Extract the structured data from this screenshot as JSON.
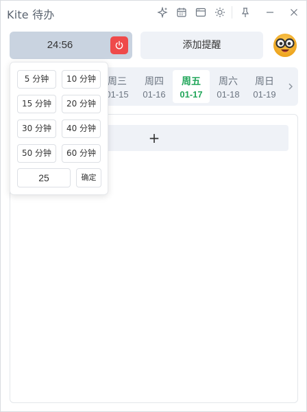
{
  "window": {
    "title": "Kite 待办"
  },
  "titlebar_icons": [
    "sparkle-icon",
    "calendar-icon",
    "window-icon",
    "sun-icon",
    "pin-icon",
    "minimize-icon",
    "close-icon"
  ],
  "timer": {
    "display": "24:56",
    "power_icon": "power-icon",
    "accent": "#ef4a4a"
  },
  "reminder": {
    "label": "添加提醒"
  },
  "week": {
    "days": [
      {
        "name": "周三",
        "date": "01-15"
      },
      {
        "name": "周四",
        "date": "01-16"
      },
      {
        "name": "周五",
        "date": "01-17",
        "active": true
      },
      {
        "name": "周六",
        "date": "01-18"
      },
      {
        "name": "周日",
        "date": "01-19"
      }
    ],
    "active_color": "#22a65a"
  },
  "main": {
    "add_label": "+"
  },
  "timer_popover": {
    "options": [
      "5 分钟",
      "10 分钟",
      "15 分钟",
      "20 分钟",
      "30 分钟",
      "40 分钟",
      "50 分钟",
      "60 分钟"
    ],
    "custom_value": "25",
    "confirm_label": "确定"
  }
}
